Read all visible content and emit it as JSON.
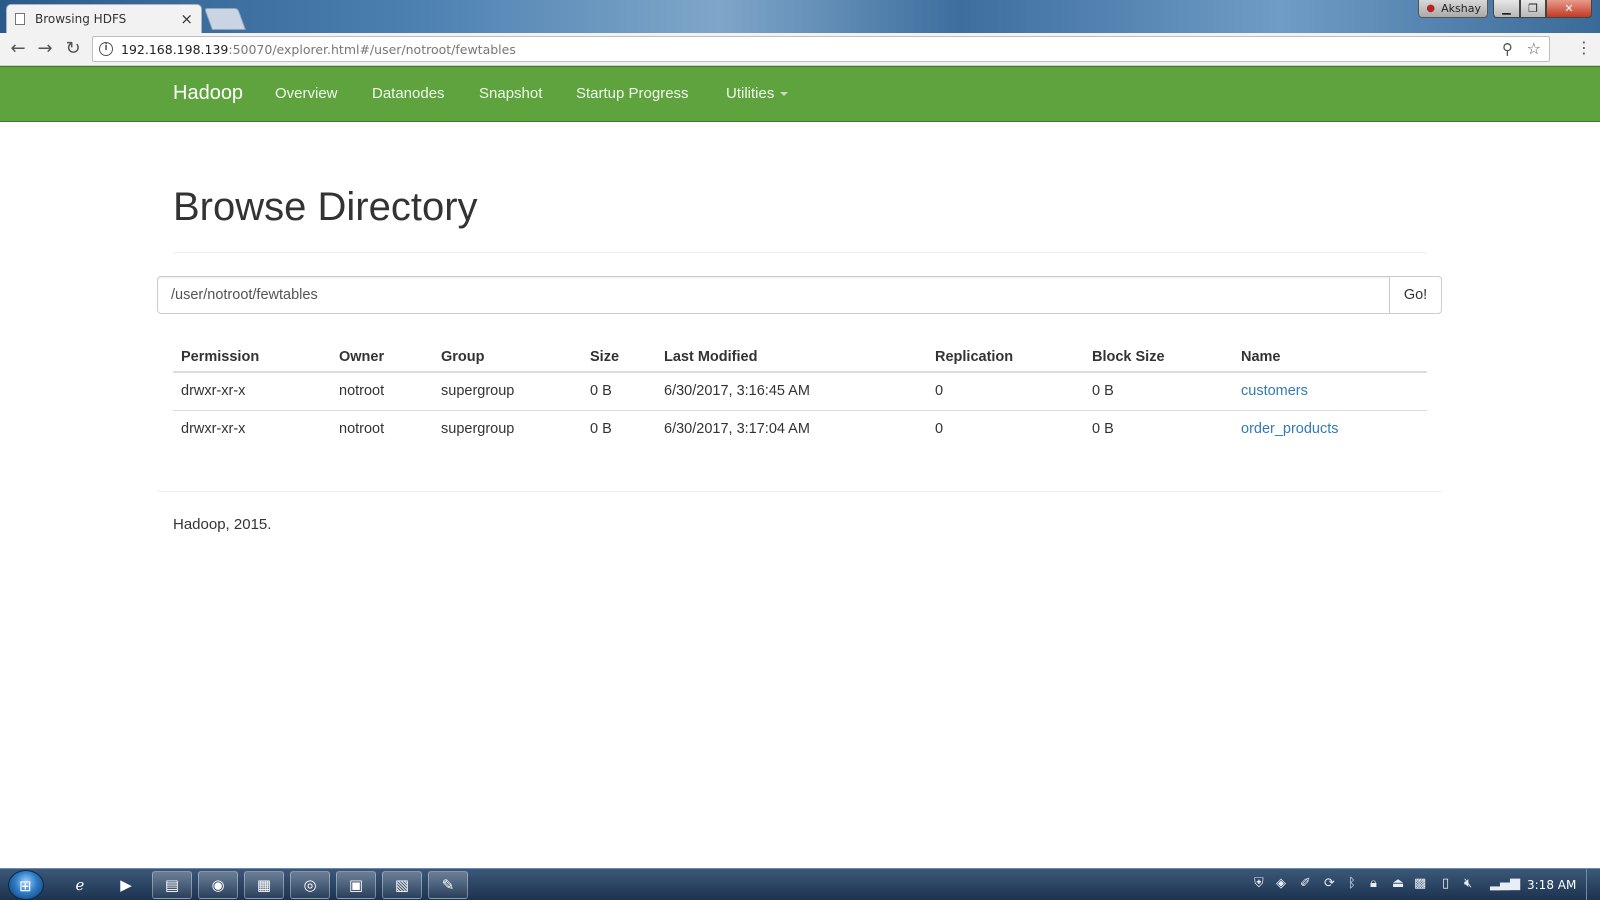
{
  "browser": {
    "tab_title": "Browsing HDFS",
    "tab_close": "×",
    "user_name": "Akshay",
    "url_host": "192.168.198.139",
    "url_rest": ":50070/explorer.html#/user/notroot/fewtables"
  },
  "navbar": {
    "brand": "Hadoop",
    "links": [
      "Overview",
      "Datanodes",
      "Snapshot",
      "Startup Progress",
      "Utilities"
    ]
  },
  "page": {
    "title": "Browse Directory",
    "path_value": "/user/notroot/fewtables",
    "go_label": "Go!"
  },
  "table": {
    "headers": [
      "Permission",
      "Owner",
      "Group",
      "Size",
      "Last Modified",
      "Replication",
      "Block Size",
      "Name"
    ],
    "rows": [
      [
        "drwxr-xr-x",
        "notroot",
        "supergroup",
        "0 B",
        "6/30/2017, 3:16:45 AM",
        "0",
        "0 B",
        "customers"
      ],
      [
        "drwxr-xr-x",
        "notroot",
        "supergroup",
        "0 B",
        "6/30/2017, 3:17:04 AM",
        "0",
        "0 B",
        "order_products"
      ]
    ]
  },
  "footer": {
    "text": "Hadoop, 2015."
  },
  "taskbar": {
    "clock": "3:18 AM",
    "pinned_icons": [
      "internet-explorer-icon",
      "media-player-icon",
      "file-explorer-icon",
      "firefox-icon",
      "notepad-icon",
      "chrome-icon",
      "network-app-icon",
      "vmware-icon",
      "python-icon"
    ]
  },
  "colors": {
    "navbar": "#5fa33e",
    "link": "#337ab7"
  }
}
